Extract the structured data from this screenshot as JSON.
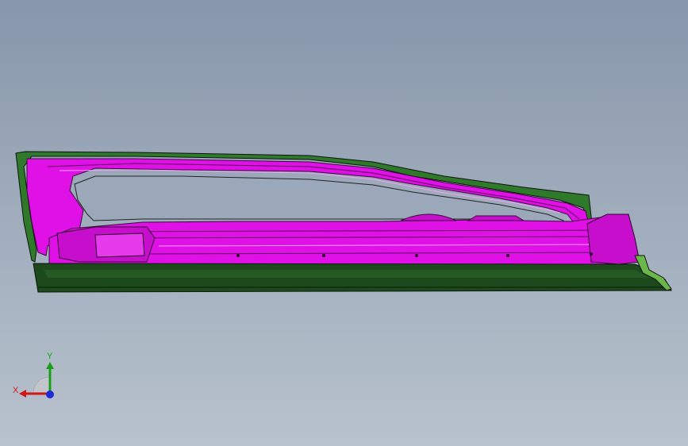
{
  "viewport": {
    "background_top": "#8796ab",
    "background_bottom": "#b8c2cd"
  },
  "model": {
    "name_icon": "door-trim-part-icon",
    "colors": {
      "body_magenta": "#e011e6",
      "body_magenta_dark": "#a00aa8",
      "edge_green": "#2f7a2a",
      "base_dark_green": "#1c4a1c",
      "edge_line": "#111111"
    }
  },
  "triad": {
    "x_label": "X",
    "y_label": "Y",
    "x_color": "#d01818",
    "y_color": "#17a017",
    "z_color": "#1d2bd6"
  }
}
